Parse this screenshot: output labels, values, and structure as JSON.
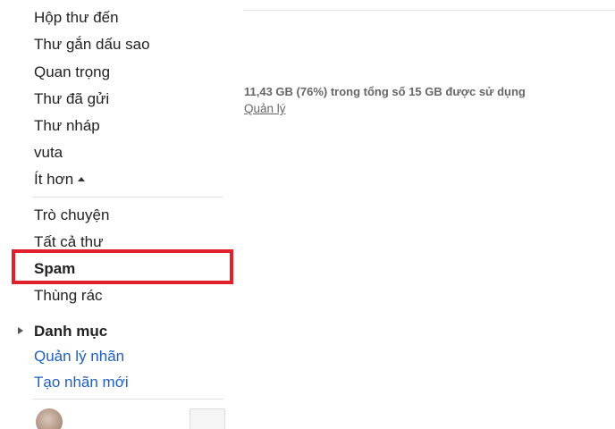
{
  "sidebar": {
    "items": [
      {
        "label": "Hộp thư đến"
      },
      {
        "label": "Thư gắn dấu sao"
      },
      {
        "label": "Quan trọng"
      },
      {
        "label": "Thư đã gửi"
      },
      {
        "label": "Thư nháp"
      },
      {
        "label": "vuta"
      },
      {
        "label": "Ít hơn"
      },
      {
        "label": "Trò chuyện"
      },
      {
        "label": "Tất cả thư"
      },
      {
        "label": "Spam"
      },
      {
        "label": "Thùng rác"
      }
    ],
    "categories_label": "Danh mục",
    "manage_labels": "Quản lý nhãn",
    "create_label": "Tạo nhãn mới"
  },
  "main": {
    "storage_text": "11,43 GB (76%) trong tổng số 15 GB được sử dụng",
    "manage_link": "Quản lý"
  },
  "colors": {
    "highlight": "#e0202a",
    "link": "#1e5fbf"
  }
}
